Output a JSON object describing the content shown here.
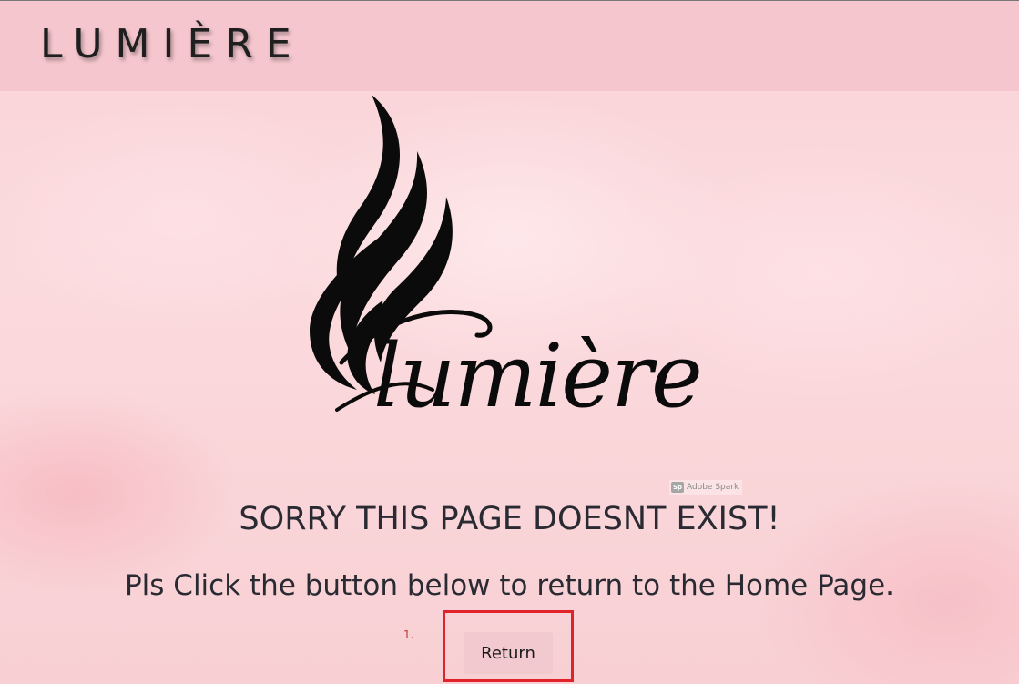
{
  "header": {
    "brand": "LUMIÈRE"
  },
  "logo": {
    "wordmark": "lumière"
  },
  "badge": {
    "icon_text": "Sp",
    "label": "Adobe Spark"
  },
  "message": {
    "heading": "SORRY THIS PAGE DOESNT EXIST!",
    "subheading": "Pls Click the button below to return to the Home Page."
  },
  "annotation": {
    "marker": "1."
  },
  "actions": {
    "return_label": "Return"
  },
  "colors": {
    "header_bg": "#f5c6ce",
    "button_bg": "#f3c9d0",
    "highlight": "#e0222a",
    "text": "#2a2a33"
  }
}
